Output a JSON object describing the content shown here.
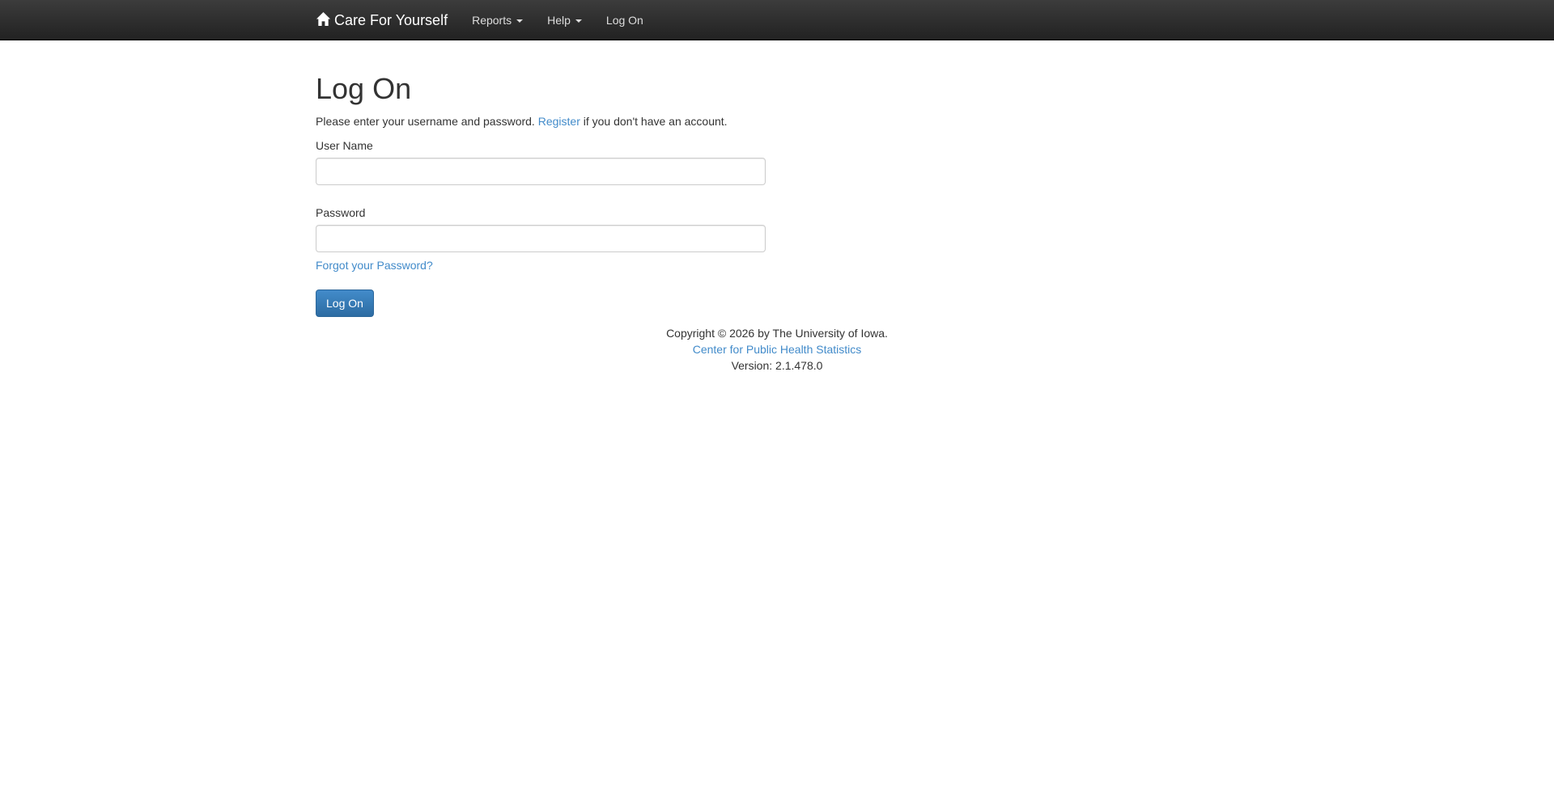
{
  "navbar": {
    "brand": "Care For Yourself",
    "items": [
      {
        "label": "Reports",
        "dropdown": true
      },
      {
        "label": "Help",
        "dropdown": true
      },
      {
        "label": "Log On",
        "dropdown": false
      }
    ],
    "icon": "home-icon"
  },
  "main": {
    "title": "Log On",
    "intro_before": "Please enter your username and password.",
    "register_link": "Register",
    "intro_after": "if you don't have an account.",
    "username_label": "User Name",
    "username_value": "",
    "password_label": "Password",
    "password_value": "",
    "forgot_link": "Forgot your Password?",
    "submit_label": "Log On"
  },
  "footer": {
    "copyright": "Copyright © 2026 by The University of Iowa.",
    "center_link": "Center for Public Health Statistics",
    "version": "Version: 2.1.478.0"
  },
  "colors": {
    "link": "#428bca",
    "navbar": "#222222",
    "button": "#428bca"
  }
}
